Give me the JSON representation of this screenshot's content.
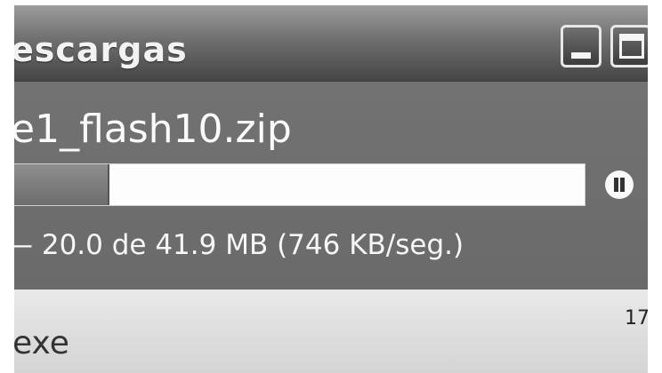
{
  "window": {
    "title": "escargas",
    "controls": {
      "minimize": "minimize-icon",
      "maximize": "maximize-icon"
    }
  },
  "download": {
    "filename": "e1_flash10.zip",
    "progress_fraction": 0.175,
    "status_text": "— 20.0 de 41.9 MB (746 KB/seg.)",
    "pause_icon": "pause-icon"
  },
  "next_item": {
    "name": "exe",
    "size": "17"
  }
}
